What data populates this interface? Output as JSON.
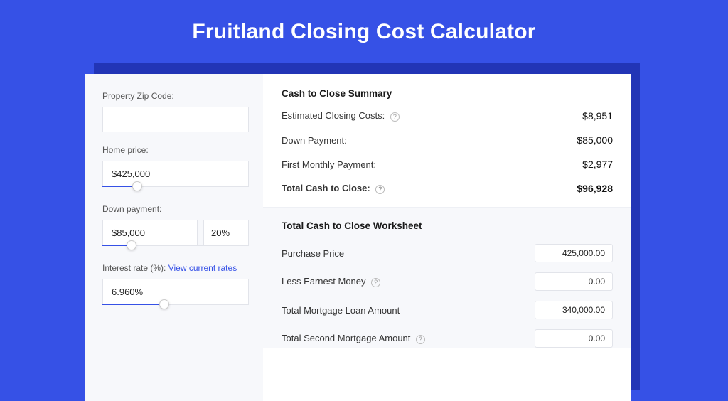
{
  "title": "Fruitland Closing Cost Calculator",
  "left": {
    "zip_label": "Property Zip Code:",
    "zip_value": "",
    "price_label": "Home price:",
    "price_value": "$425,000",
    "price_slider_pct": 24,
    "down_label": "Down payment:",
    "down_value": "$85,000",
    "down_pct_value": "20%",
    "down_slider_pct": 20,
    "rate_label": "Interest rate (%): ",
    "rate_link": "View current rates",
    "rate_value": "6.960%",
    "rate_slider_pct": 42
  },
  "summary": {
    "heading": "Cash to Close Summary",
    "rows": [
      {
        "label": "Estimated Closing Costs:",
        "value": "$8,951",
        "help": true
      },
      {
        "label": "Down Payment:",
        "value": "$85,000",
        "help": false
      },
      {
        "label": "First Monthly Payment:",
        "value": "$2,977",
        "help": false
      }
    ],
    "total_label": "Total Cash to Close:",
    "total_value": "$96,928"
  },
  "worksheet": {
    "heading": "Total Cash to Close Worksheet",
    "rows": [
      {
        "label": "Purchase Price",
        "value": "425,000.00",
        "help": false
      },
      {
        "label": "Less Earnest Money",
        "value": "0.00",
        "help": true
      },
      {
        "label": "Total Mortgage Loan Amount",
        "value": "340,000.00",
        "help": false
      },
      {
        "label": "Total Second Mortgage Amount",
        "value": "0.00",
        "help": true
      }
    ]
  }
}
